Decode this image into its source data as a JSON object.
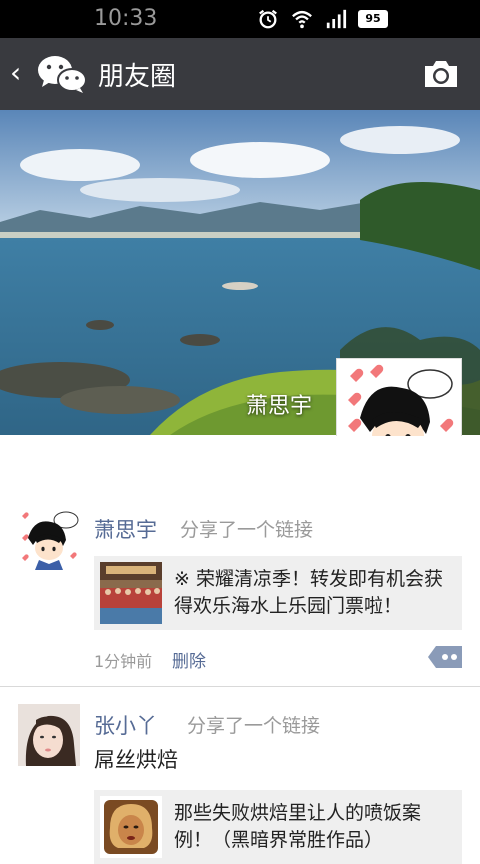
{
  "status_bar": {
    "battery": "95",
    "time": "10:33",
    "icons": [
      "alarm-icon",
      "wifi-icon",
      "signal-icon",
      "battery-icon"
    ]
  },
  "action_bar": {
    "back_glyph": "‹",
    "title": "朋友圈",
    "icons": [
      "wechat-logo-icon",
      "camera-icon"
    ]
  },
  "cover": {
    "user_name": "萧思宇"
  },
  "posts": [
    {
      "name": "萧思宇",
      "action": "分享了一个链接",
      "link_text": "※ 荣耀清凉季！转发即有机会获得欢乐海水上乐园门票啦！",
      "time": "1分钟前",
      "delete_label": "删除"
    },
    {
      "name": "张小丫",
      "action": "分享了一个链接",
      "text": "屌丝烘焙",
      "link_text": "那些失败烘焙里让人的喷饭案例！（黑暗界常胜作品）"
    }
  ],
  "colors": {
    "statusbar": "#000000",
    "actionbar": "#393a3f",
    "name_blue": "#566b95",
    "gray_text": "#9a9a9a",
    "card_bg": "#efefef"
  }
}
